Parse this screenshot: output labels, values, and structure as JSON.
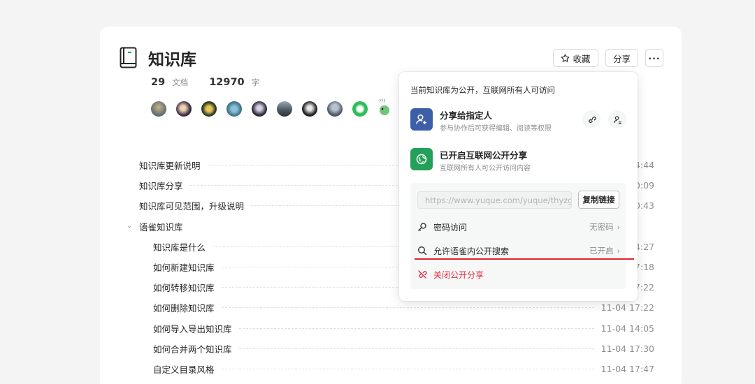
{
  "library": {
    "title": "知识库",
    "doc_count": "29",
    "doc_count_label": "文档",
    "word_count": "12970",
    "word_count_label": "字"
  },
  "header_buttons": {
    "favorite_label": "收藏",
    "share_label": "分享",
    "more_label": "···"
  },
  "members": [
    "avatar-1",
    "avatar-2",
    "avatar-3",
    "avatar-4",
    "avatar-5",
    "avatar-6",
    "avatar-7",
    "avatar-8",
    "avatar-9",
    "avatar-10"
  ],
  "documents": [
    {
      "title": "知识库更新说明",
      "time": "4:44",
      "level": 0
    },
    {
      "title": "知识库分享",
      "time": "0:09",
      "level": 0
    },
    {
      "title": "知识库可见范围，升级说明",
      "time": "0:43",
      "level": 0
    },
    {
      "title": "语雀知识库",
      "time": "",
      "level": 0,
      "group": true
    },
    {
      "title": "知识库是什么",
      "time": "4:27",
      "level": 1
    },
    {
      "title": "如何新建知识库",
      "time": "7:18",
      "level": 1
    },
    {
      "title": "如何转移知识库",
      "time": "7:22",
      "level": 1
    },
    {
      "title": "如何删除知识库",
      "time": "11-04 17:22",
      "level": 1
    },
    {
      "title": "如何导入导出知识库",
      "time": "11-04 14:05",
      "level": 1
    },
    {
      "title": "如何合并两个知识库",
      "time": "11-04 17:30",
      "level": 1
    },
    {
      "title": "自定义目录风格",
      "time": "11-04 17:47",
      "level": 1
    }
  ],
  "share_popover": {
    "status_text": "当前知识库为公开，互联网所有人可访问",
    "share_to_people": {
      "title": "分享给指定人",
      "subtitle": "参与协作后可获得编辑、阅读等权限"
    },
    "public_share": {
      "title": "已开启互联网公开分享",
      "subtitle": "互联网所有人可公开访问内容"
    },
    "link_url": "https://www.yuque.com/yuque/thyzgp",
    "copy_link_label": "复制链接",
    "password_access": {
      "label": "密码访问",
      "value": "无密码"
    },
    "search_access": {
      "label": "允许语雀内公开搜索",
      "value": "已开启"
    },
    "close_share_label": "关闭公开分享"
  },
  "colors": {
    "accent_blue": "#3d5fa8",
    "accent_green": "#23a15a",
    "danger_red": "#df2a3f",
    "highlight_line": "#e0242f"
  }
}
